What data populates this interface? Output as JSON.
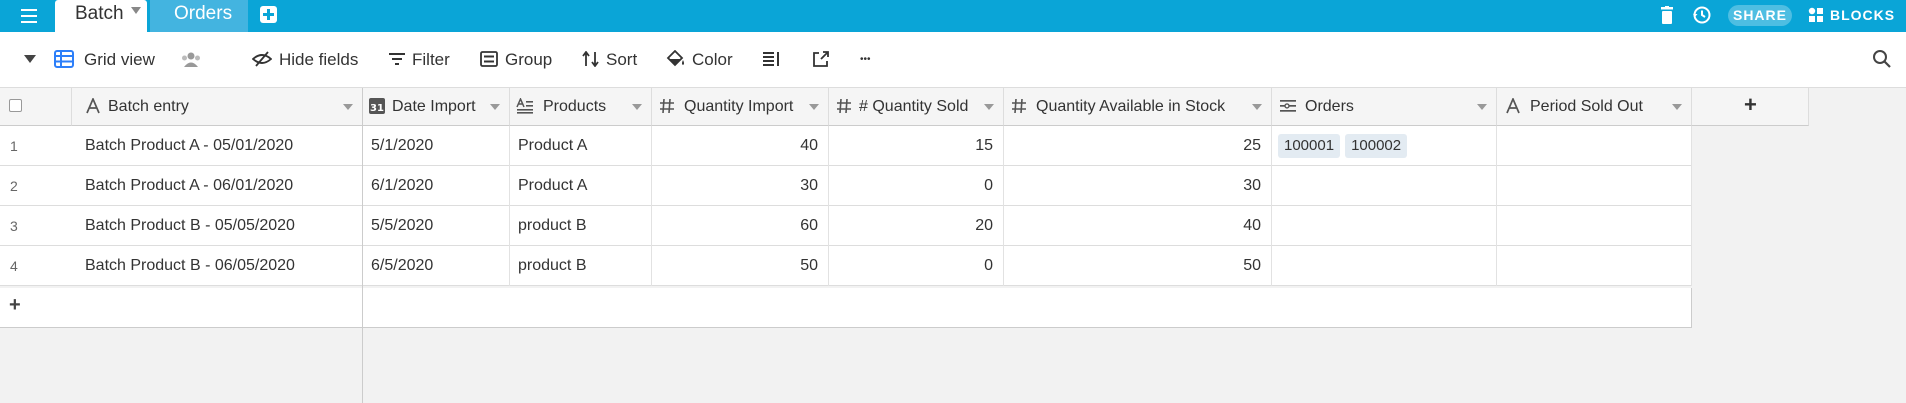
{
  "tabs": {
    "active": "Batch",
    "other": "Orders"
  },
  "topbar": {
    "share_label": "SHARE",
    "blocks_label": "BLOCKS"
  },
  "viewbar": {
    "view_name": "Grid view",
    "hide_fields": "Hide fields",
    "filter": "Filter",
    "group": "Group",
    "sort": "Sort",
    "color": "Color",
    "more": "•••"
  },
  "columns": [
    "Batch entry",
    "Date Import",
    "Products",
    "Quantity Import",
    "# Quantity Sold",
    "Quantity Available in Stock",
    "Orders",
    "Period Sold Out"
  ],
  "add_column": "+",
  "add_row": "+",
  "rows": [
    {
      "num": "1",
      "entry": "Batch Product A - 05/01/2020",
      "date": "5/1/2020",
      "product": "Product A",
      "qty_import": "40",
      "qty_sold": "15",
      "qty_avail": "25",
      "orders": [
        "100001",
        "100002"
      ],
      "period": ""
    },
    {
      "num": "2",
      "entry": "Batch Product A - 06/01/2020",
      "date": "6/1/2020",
      "product": "Product A",
      "qty_import": "30",
      "qty_sold": "0",
      "qty_avail": "30",
      "orders": [],
      "period": ""
    },
    {
      "num": "3",
      "entry": "Batch Product B - 05/05/2020",
      "date": "5/5/2020",
      "product": "product B",
      "qty_import": "60",
      "qty_sold": "20",
      "qty_avail": "40",
      "orders": [],
      "period": ""
    },
    {
      "num": "4",
      "entry": "Batch Product B - 06/05/2020",
      "date": "6/5/2020",
      "product": "product B",
      "qty_import": "50",
      "qty_sold": "0",
      "qty_avail": "50",
      "orders": [],
      "period": ""
    }
  ],
  "colors": {
    "topbar": "#0aa5d7",
    "accent": "#2d7ff9",
    "chip_bg": "#e3ebf2"
  }
}
